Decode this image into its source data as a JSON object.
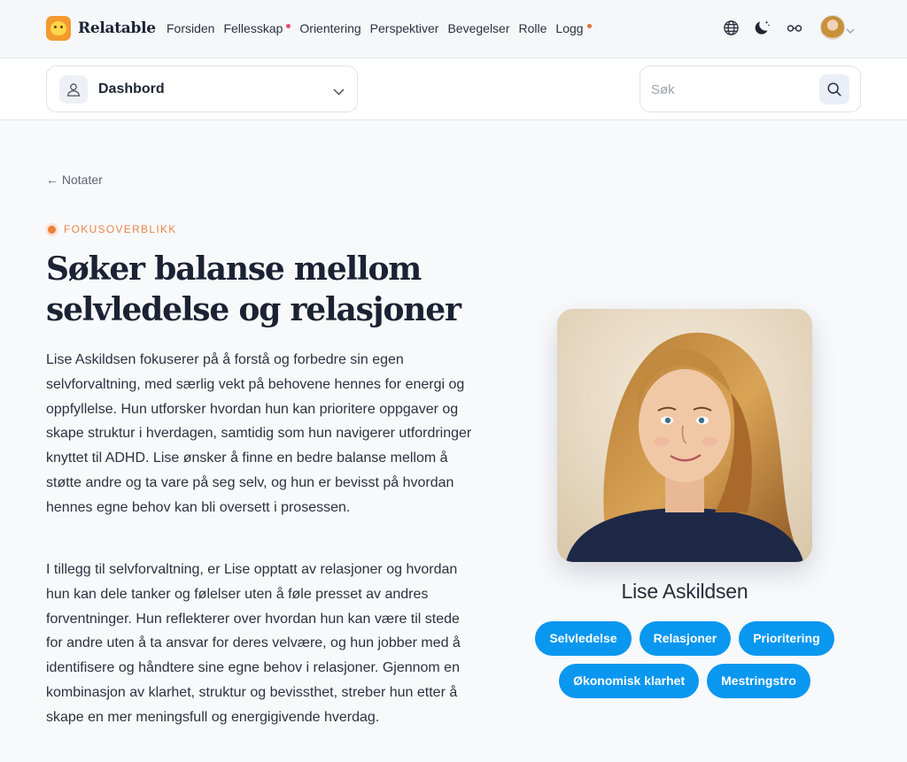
{
  "app": {
    "brand": "Relatable",
    "logo_icon": "smiley-face-logo",
    "colors": {
      "accent": "#0a97ef",
      "eyebrow": "#e8854a",
      "nav_dot_pink": "#e94a77",
      "nav_dot_orange": "#e0703a"
    }
  },
  "nav": {
    "items": [
      {
        "label": "Forsiden",
        "dot": false
      },
      {
        "label": "Fellesskap",
        "dot": "pink"
      },
      {
        "label": "Orientering",
        "dot": false
      },
      {
        "label": "Perspektiver",
        "dot": false
      },
      {
        "label": "Bevegelser",
        "dot": false
      },
      {
        "label": "Rolle",
        "dot": false
      },
      {
        "label": "Logg",
        "dot": "orange"
      }
    ],
    "icons": [
      "globe-icon",
      "moon-icon",
      "glasses-icon"
    ]
  },
  "toolbar": {
    "dashboard_label": "Dashbord",
    "search_placeholder": "Søk"
  },
  "main": {
    "back_link": "← Notater",
    "eyebrow": "FOKUSOVERBLIKK",
    "headline": "Søker balanse mellom selvledelse og relasjoner",
    "paragraphs": [
      "Lise Askildsen fokuserer på å forstå og forbedre sin egen selvforvaltning, med særlig vekt på behovene hennes for energi og oppfyllelse. Hun utforsker hvordan hun kan prioritere oppgaver og skape struktur i hverdagen, samtidig som hun navigerer utfordringer knyttet til ADHD. Lise ønsker å finne en bedre balanse mellom å støtte andre og ta vare på seg selv, og hun er bevisst på hvordan hennes egne behov kan bli oversett i prosessen.",
      "I tillegg til selvforvaltning, er Lise opptatt av relasjoner og hvordan hun kan dele tanker og følelser uten å føle presset av andres forventninger. Hun reflekterer over hvordan hun kan være til stede for andre uten å ta ansvar for deres velvære, og hun jobber med å identifisere og håndtere sine egne behov i relasjoner. Gjennom en kombinasjon av klarhet, struktur og bevissthet, streber hun etter å skape en mer meningsfull og energigivende hverdag."
    ]
  },
  "profile": {
    "name": "Lise Askildsen",
    "tags": [
      "Selvledelse",
      "Relasjoner",
      "Prioritering",
      "Økonomisk klarhet",
      "Mestringstro"
    ]
  }
}
